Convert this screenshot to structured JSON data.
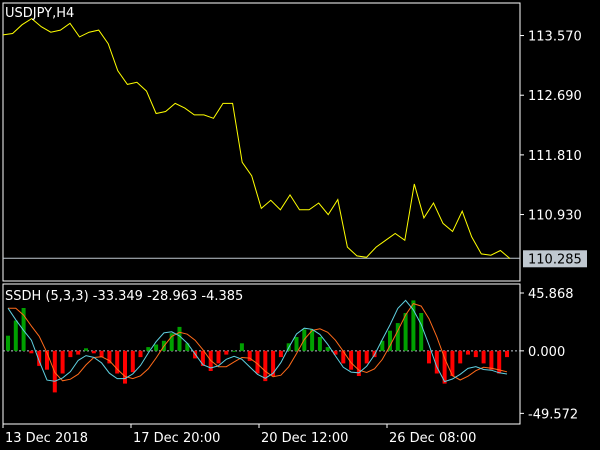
{
  "chart_data": [
    {
      "type": "line",
      "title": "USDJPY,H4",
      "ylim": [
        109.95,
        114.05
      ],
      "yticks": [
        {
          "value": 113.57,
          "label": "113.570"
        },
        {
          "value": 112.69,
          "label": "112.690"
        },
        {
          "value": 111.81,
          "label": "111.810"
        },
        {
          "value": 110.93,
          "label": "110.930"
        }
      ],
      "current_price": {
        "value": 110.285,
        "label": "110.285"
      },
      "colors": {
        "line": "#ffff00",
        "level": "#c0c8d0",
        "tag_bg": "#c0c8d0"
      },
      "series": [
        {
          "values": [
            113.58,
            113.6,
            113.73,
            113.82,
            113.7,
            113.62,
            113.65,
            113.75,
            113.55,
            113.62,
            113.65,
            113.45,
            113.05,
            112.85,
            112.88,
            112.75,
            112.42,
            112.45,
            112.57,
            112.5,
            112.4,
            112.4,
            112.35,
            112.57,
            112.57,
            111.7,
            111.5,
            111.02,
            111.14,
            111.0,
            111.22,
            111.0,
            111.0,
            111.1,
            110.93,
            111.15,
            110.45,
            110.32,
            110.3,
            110.45,
            110.55,
            110.65,
            110.55,
            111.38,
            110.88,
            111.1,
            110.8,
            110.68,
            110.98,
            110.6,
            110.35,
            110.33,
            110.4,
            110.28
          ]
        }
      ]
    },
    {
      "type": "line",
      "title": "SSDH (5,3,3) -33.349 -28.963 -4.385",
      "ylim": [
        -58,
        53
      ],
      "yticks": [
        {
          "value": 45.868,
          "label": "45.868"
        },
        {
          "value": 0,
          "label": "0.000"
        },
        {
          "value": -49.572,
          "label": "-49.572"
        }
      ],
      "colors": {
        "up": "#00a000",
        "down": "#ff0000",
        "main": "#5fd0e0",
        "signal": "#ff6a1a",
        "zero": "#c0c8d0"
      },
      "histogram": [
        12,
        24,
        34,
        -2,
        -12,
        -15,
        -33,
        -18,
        -5,
        -3,
        2,
        -2,
        -5,
        -10,
        -18,
        -26,
        -17,
        -5,
        3,
        5,
        8,
        14,
        19,
        6,
        -6,
        -12,
        -16,
        -10,
        -3,
        0,
        6,
        -8,
        -18,
        -24,
        -20,
        -5,
        6,
        11,
        17,
        17,
        11,
        3,
        -3,
        -10,
        -15,
        -20,
        -10,
        -5,
        8,
        16,
        22,
        30,
        40,
        30,
        -10,
        -18,
        -26,
        -20,
        -10,
        -3,
        -5,
        -10,
        -15,
        -18,
        -5
      ]
    }
  ],
  "x_axis_labels": [
    "13 Dec 2018",
    "17 Dec 20:00",
    "20 Dec 12:00",
    "26 Dec 08:00"
  ]
}
